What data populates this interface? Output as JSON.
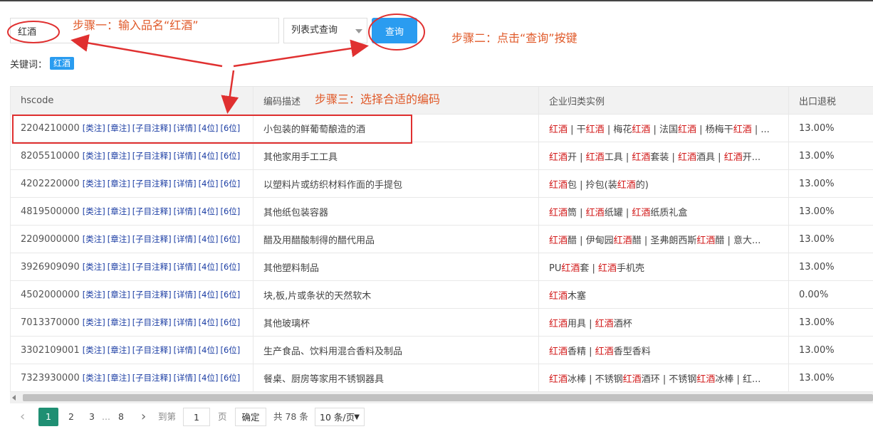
{
  "search": {
    "value": "红酒",
    "mode": "列表式查询",
    "button": "查询"
  },
  "keywords": {
    "label": "关键词：",
    "tag": "红酒"
  },
  "table": {
    "headers": [
      "hscode",
      "编码描述",
      "企业归类实例",
      "出口退税"
    ],
    "link_labels": [
      "[类注]",
      "[章注]",
      "[子目注释]",
      "[详情]",
      "[4位]",
      "[6位]"
    ],
    "rows": [
      {
        "code": "2204210000",
        "desc": "小包装的鲜葡萄酿造的酒",
        "examples": "红酒 | 干红酒 | 梅花红酒 | 法国红酒 | 杨梅干红酒 | ...",
        "rebate": "13.00%"
      },
      {
        "code": "8205510000",
        "desc": "其他家用手工工具",
        "examples": "红酒开 | 红酒工具 | 红酒套装 | 红酒酒具 | 红酒开...",
        "rebate": "13.00%"
      },
      {
        "code": "4202220000",
        "desc": "以塑料片或纺织材料作面的手提包",
        "examples": "红酒包 | 拎包(装红酒的)",
        "rebate": "13.00%"
      },
      {
        "code": "4819500000",
        "desc": "其他纸包装容器",
        "examples": "红酒筒 | 红酒纸罐 | 红酒纸质礼盒",
        "rebate": "13.00%"
      },
      {
        "code": "2209000000",
        "desc": "醋及用醋酸制得的醋代用品",
        "examples": "红酒醋 | 伊甸园红酒醋 | 圣弗朗西斯红酒醋 | 意大...",
        "rebate": "13.00%"
      },
      {
        "code": "3926909090",
        "desc": "其他塑料制品",
        "examples": "PU红酒套 | 红酒手机壳",
        "rebate": "13.00%"
      },
      {
        "code": "4502000000",
        "desc": "块,板,片或条状的天然软木",
        "examples": "红酒木塞",
        "rebate": "0.00%"
      },
      {
        "code": "7013370000",
        "desc": "其他玻璃杯",
        "examples": "红酒用具 | 红酒酒杯",
        "rebate": "13.00%"
      },
      {
        "code": "3302109001",
        "desc": "生产食品、饮料用混合香料及制品",
        "examples": "红酒香精 | 红酒香型香料",
        "rebate": "13.00%"
      },
      {
        "code": "7323930000",
        "desc": "餐桌、厨房等家用不锈钢器具",
        "examples": "红酒冰棒 | 不锈钢红酒酒环 | 不锈钢红酒冰棒 | 红...",
        "rebate": "13.00%"
      }
    ]
  },
  "pagination": {
    "pages": [
      "1",
      "2",
      "3",
      "...",
      "8"
    ],
    "goto_label": "到第",
    "goto_value": "1",
    "page_unit": "页",
    "confirm": "确定",
    "total": "共 78 条",
    "page_size": "10 条/页"
  },
  "annotations": {
    "step1": "步骤一：输入品名“红酒”",
    "step2": "步骤二：点击“查询”按键",
    "step3": "步骤三：选择合适的编码",
    "color": "#e03030"
  },
  "colors": {
    "primary": "#2a9cf0",
    "highlight": "#d21a1a",
    "link": "#1a3ca3",
    "current_page": "#1f8f73"
  }
}
